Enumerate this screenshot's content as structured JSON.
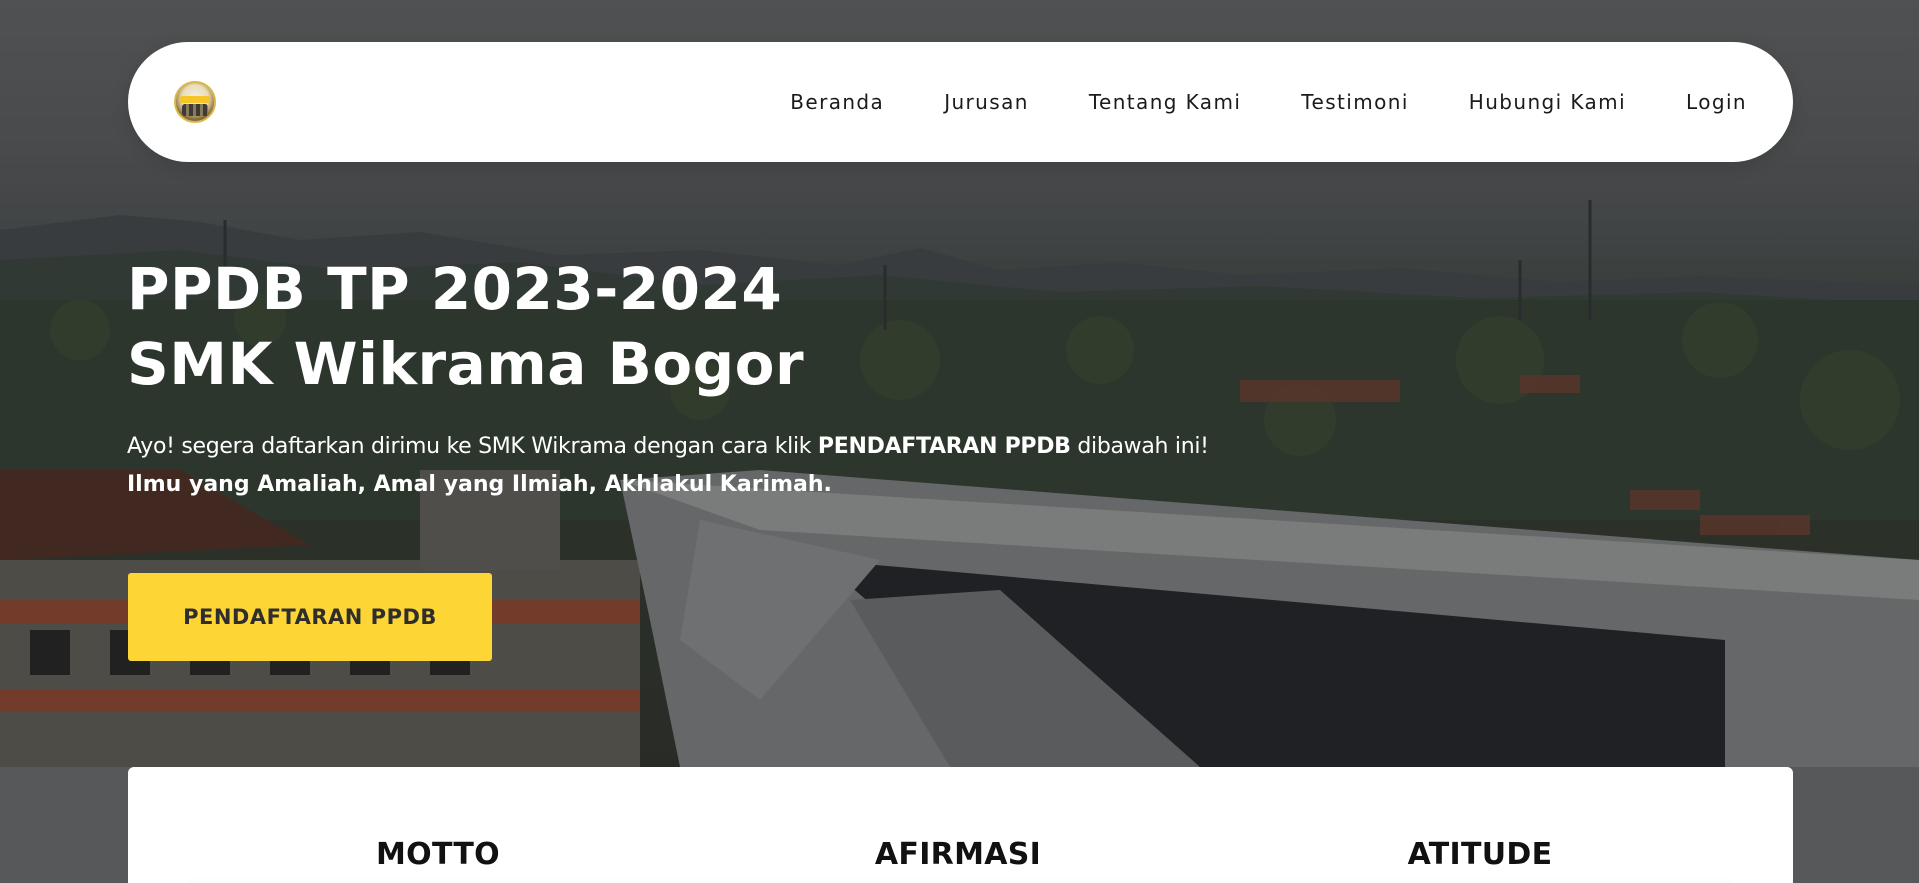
{
  "navbar": {
    "logo_alt": "PPDB",
    "links": [
      "Beranda",
      "Jurusan",
      "Tentang Kami",
      "Testimoni",
      "Hubungi Kami",
      "Login"
    ]
  },
  "hero": {
    "title_line1": "PPDB TP 2023-2024",
    "title_line2": "SMK Wikrama Bogor",
    "desc_prefix": "Ayo! segera daftarkan dirimu ke SMK Wikrama dengan cara klik ",
    "desc_bold": "PENDAFTARAN PPDB",
    "desc_suffix": " dibawah ini!",
    "tagline": "Ilmu yang Amaliah, Amal yang Ilmiah, Akhlakul Karimah.",
    "cta_label": "PENDAFTARAN PPDB"
  },
  "card": {
    "columns": [
      "MOTTO",
      "AFIRMASI",
      "ATITUDE"
    ]
  },
  "colors": {
    "accent": "#fdd535",
    "nav_bg": "#ffffff",
    "text_dark": "#1b1b1b"
  }
}
